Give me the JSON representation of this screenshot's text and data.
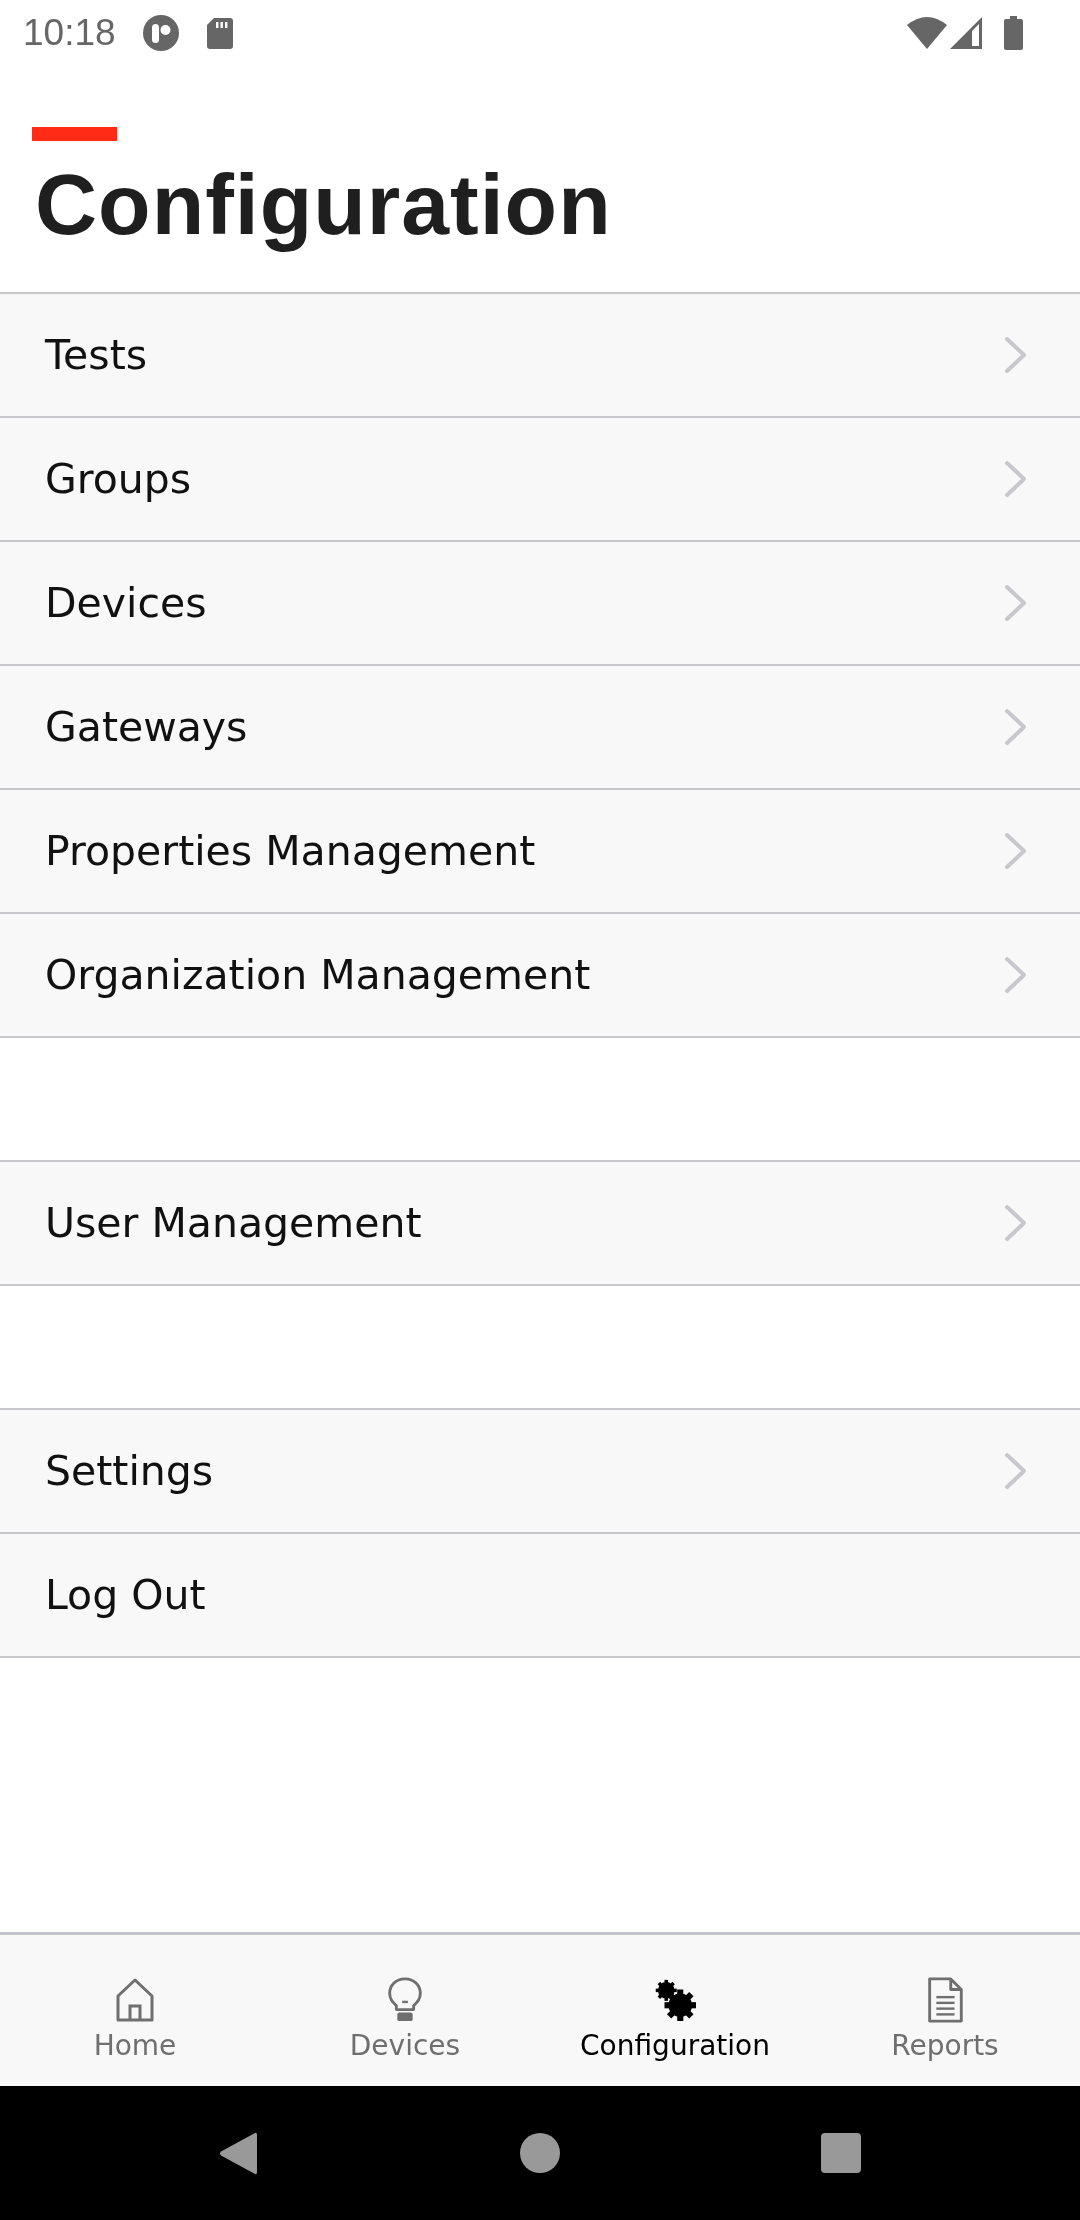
{
  "status_bar": {
    "time": "10:18"
  },
  "header": {
    "title": "Configuration"
  },
  "sections": [
    {
      "items": [
        {
          "label": "Tests",
          "kind": "navigate"
        },
        {
          "label": "Groups",
          "kind": "navigate"
        },
        {
          "label": "Devices",
          "kind": "navigate"
        },
        {
          "label": "Gateways",
          "kind": "navigate"
        },
        {
          "label": "Properties Management",
          "kind": "navigate"
        },
        {
          "label": "Organization Management",
          "kind": "navigate"
        }
      ]
    },
    {
      "items": [
        {
          "label": "User Management",
          "kind": "navigate"
        }
      ]
    },
    {
      "items": [
        {
          "label": "Settings",
          "kind": "navigate"
        },
        {
          "label": "Log Out",
          "kind": "action"
        }
      ]
    }
  ],
  "bottom_nav": {
    "tabs": [
      {
        "label": "Home",
        "selected": false
      },
      {
        "label": "Devices",
        "selected": false
      },
      {
        "label": "Configuration",
        "selected": true
      },
      {
        "label": "Reports",
        "selected": false
      }
    ]
  }
}
